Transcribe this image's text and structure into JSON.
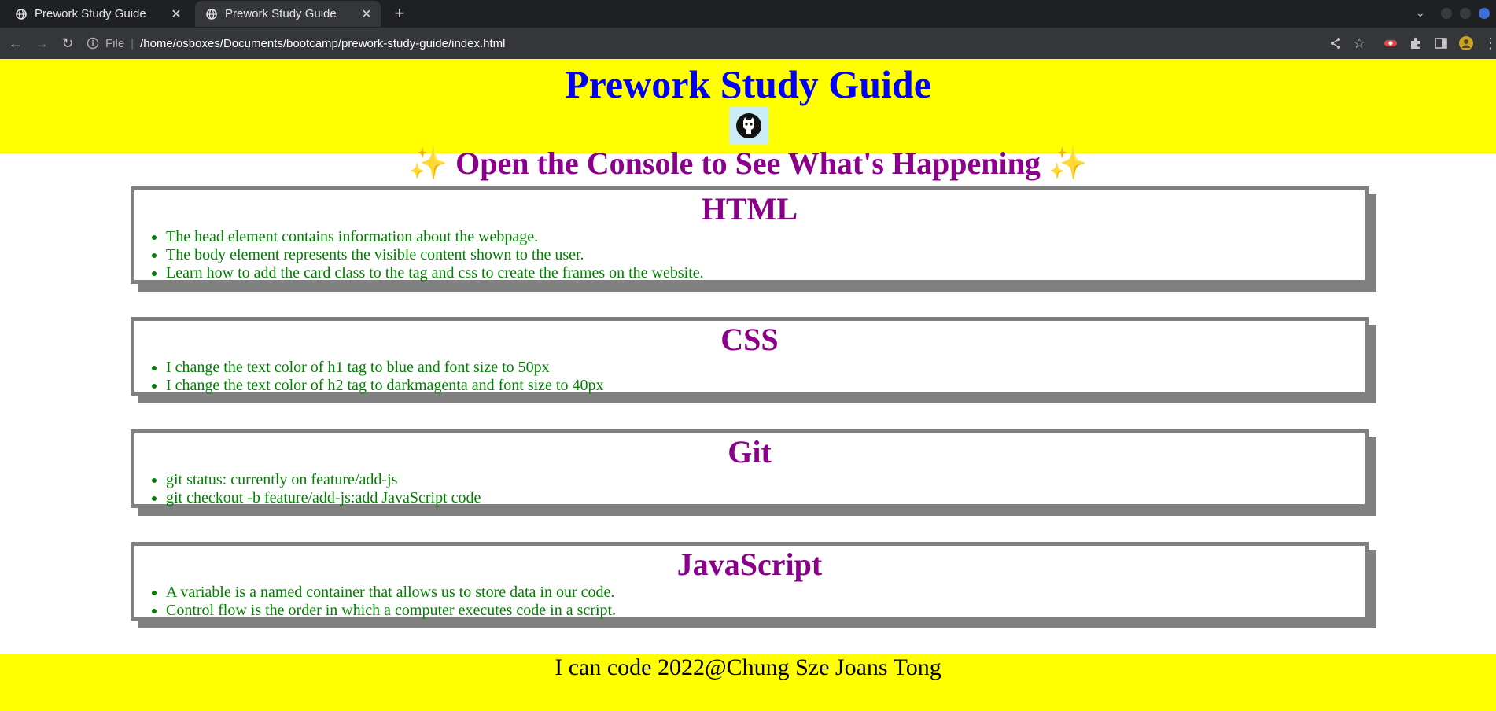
{
  "browser": {
    "tabs": [
      {
        "title": "Prework Study Guide",
        "active": false,
        "favicon": "globe-icon"
      },
      {
        "title": "Prework Study Guide",
        "active": true,
        "favicon": "globe-icon"
      }
    ],
    "new_tab_label": "+",
    "address": {
      "scheme_label": "File",
      "url": "/home/osboxes/Documents/bootcamp/prework-study-guide/index.html"
    }
  },
  "page": {
    "title": "Prework Study Guide",
    "console_banner": "✨ Open the Console to See What's Happening ✨",
    "sections": [
      {
        "heading": "HTML",
        "items": [
          "The head element contains information about the webpage.",
          "The body element represents the visible content shown to the user.",
          "Learn how to add the card class to the tag and css to create the frames on the website."
        ]
      },
      {
        "heading": "CSS",
        "items": [
          "I change the text color of h1 tag to blue and font size to 50px",
          "I change the text color of h2 tag to darkmagenta and font size to 40px"
        ]
      },
      {
        "heading": "Git",
        "items": [
          "git status: currently on feature/add-js",
          "git checkout -b feature/add-js:add JavaScript code"
        ]
      },
      {
        "heading": "JavaScript",
        "items": [
          "A variable is a named container that allows us to store data in our code.",
          "Control flow is the order in which a computer executes code in a script."
        ]
      }
    ],
    "footer": "I can code 2022@Chung Sze Joans Tong"
  },
  "colors": {
    "header_bg": "#ffff00",
    "title": "#0000ff",
    "heading": "#8b008b",
    "list_text": "#008000",
    "card_border": "#808080"
  }
}
